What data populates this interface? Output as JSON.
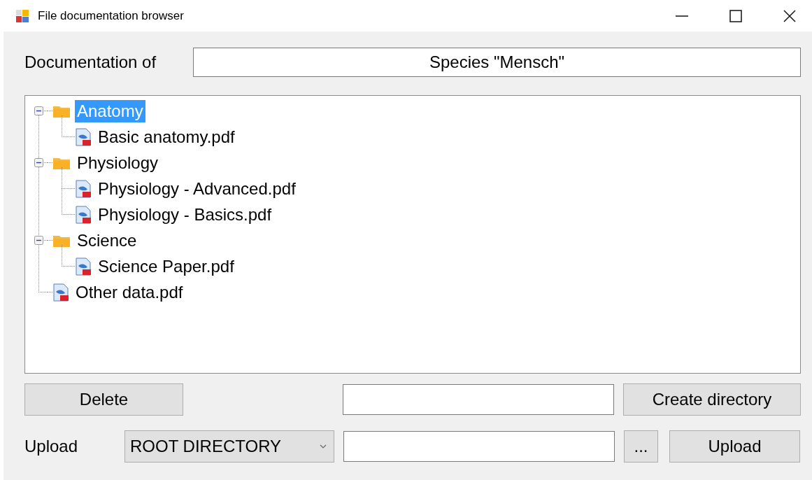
{
  "window": {
    "title": "File documentation browser"
  },
  "documentation": {
    "label": "Documentation of",
    "value": "Species \"Mensch\""
  },
  "tree": [
    {
      "kind": "folder",
      "label": "Anatomy",
      "expanded": true,
      "selected": true,
      "children": [
        {
          "kind": "file",
          "label": "Basic anatomy.pdf",
          "selected": false
        }
      ]
    },
    {
      "kind": "folder",
      "label": "Physiology",
      "expanded": true,
      "selected": false,
      "children": [
        {
          "kind": "file",
          "label": "Physiology - Advanced.pdf",
          "selected": false
        },
        {
          "kind": "file",
          "label": "Physiology - Basics.pdf",
          "selected": false
        }
      ]
    },
    {
      "kind": "folder",
      "label": "Science",
      "expanded": true,
      "selected": false,
      "children": [
        {
          "kind": "file",
          "label": "Science Paper.pdf",
          "selected": false
        }
      ]
    },
    {
      "kind": "file",
      "label": "Other data.pdf",
      "selected": false
    }
  ],
  "delete_button": "Delete",
  "create_button": "Create directory",
  "upload": {
    "label": "Upload",
    "target": "ROOT DIRECTORY",
    "browse_button": "...",
    "button": "Upload"
  }
}
